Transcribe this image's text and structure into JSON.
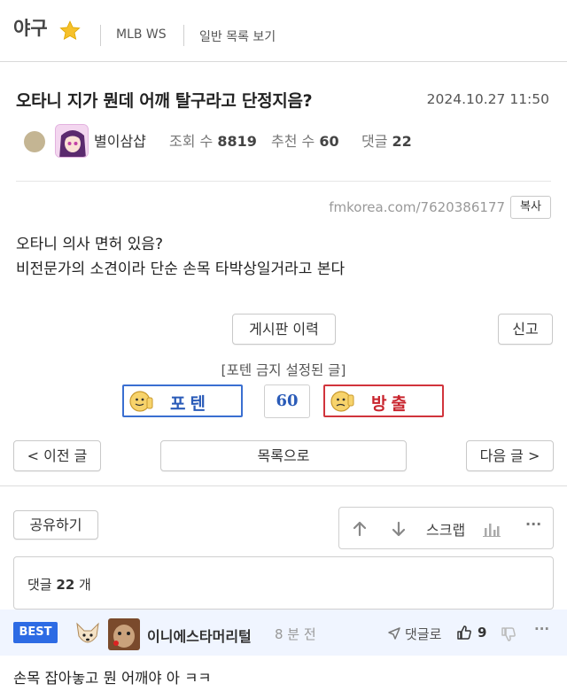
{
  "header": {
    "board_title": "야구",
    "links": [
      "MLB WS",
      "일반 목록 보기"
    ]
  },
  "post": {
    "title": "오타니 지가 뭔데 어깨 탈구라고 단정지음?",
    "date": "2024.10.27 11:50",
    "author": "별이삼샵",
    "views_label": "조회 수",
    "views": "8819",
    "recommend_label": "추천 수",
    "recommend": "60",
    "comments_label": "댓글",
    "comments": "22",
    "url": "fmkorea.com/7620386177",
    "copy_label": "복사",
    "body": [
      "오타니 의사 면허 있음?",
      "비전문가의 소견이라 단순 손목 타박상일거라고 본다"
    ]
  },
  "actions": {
    "history": "게시판 이력",
    "report": "신고",
    "vote_note": "[포텐 금지 설정된 글]",
    "up_label": "포텐",
    "up_count": "60",
    "down_label": "방출",
    "prev": "< 이전 글",
    "list": "목록으로",
    "next": "다음 글 >",
    "share": "공유하기",
    "scrap": "스크랩",
    "more": "···"
  },
  "comments_box": {
    "label": "댓글",
    "count": "22",
    "unit": "개"
  },
  "best_comment": {
    "badge": "BEST",
    "author": "이니에스타머리털",
    "time": "8 분 전",
    "reply_label": "댓글로",
    "likes": "9",
    "more": "···",
    "text": "손목 잡아놓고 뭔 어깨야 아 ㅋㅋ"
  },
  "colors": {
    "accent_blue": "#2d6be4",
    "up_border": "#3a6fd1",
    "down_border": "#d1343c",
    "best_bg": "#f0f5ff"
  }
}
